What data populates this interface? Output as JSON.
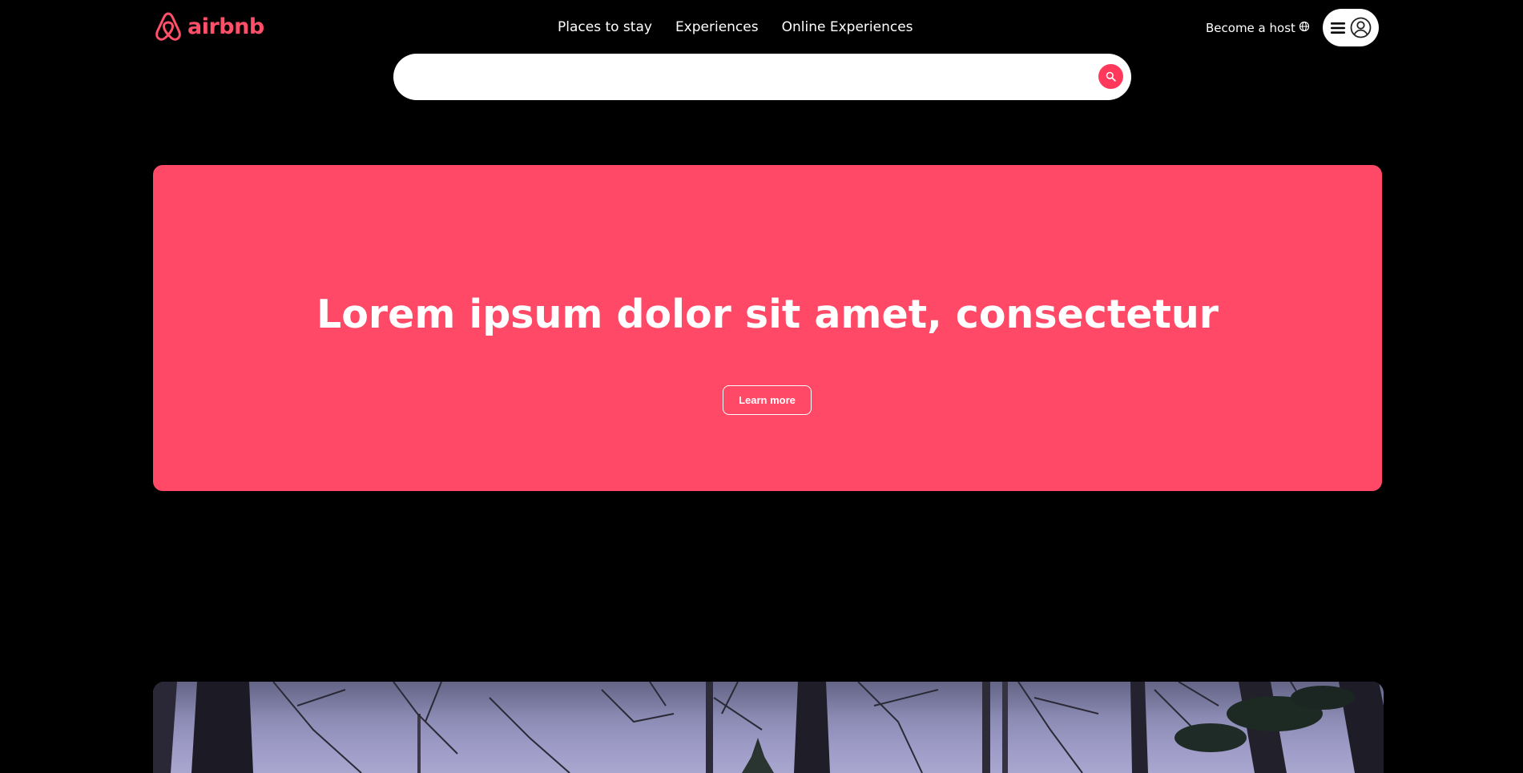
{
  "brand": {
    "name": "airbnb",
    "color": "#ff4f69",
    "logo_icon": "airbnb-belo-icon"
  },
  "nav": {
    "links": [
      "Places to stay",
      "Experiences",
      "Online Experiences"
    ],
    "become_host": "Become a host",
    "globe_icon": "globe-icon",
    "menu_icon": "hamburger-icon",
    "avatar_icon": "user-circle-icon"
  },
  "search": {
    "placeholder": "",
    "button_icon": "search-icon",
    "button_color": "#ff385c"
  },
  "hero": {
    "title": "Lorem ipsum dolor sit amet, consectetur",
    "button_label": "Learn more",
    "background_color": "#ff4966"
  },
  "photo": {
    "description_icon": "forest-photo"
  }
}
